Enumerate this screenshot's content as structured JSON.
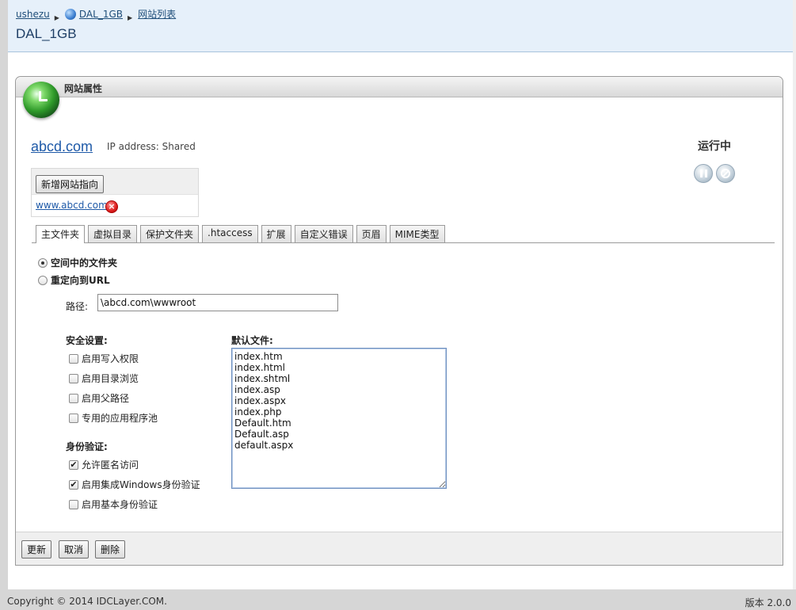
{
  "breadcrumb": {
    "items": [
      "ushezu",
      "DAL_1GB",
      "网站列表"
    ]
  },
  "header": {
    "title": "DAL_1GB"
  },
  "panel": {
    "title": "网站属性"
  },
  "site": {
    "domain": "abcd.com",
    "ip_info": "IP address: Shared",
    "status": "运行中"
  },
  "pointers": {
    "add_button": "新增网站指向",
    "items": [
      "www.abcd.com"
    ]
  },
  "tabs": [
    "主文件夹",
    "虚拟目录",
    "保护文件夹",
    ".htaccess",
    "扩展",
    "自定义错误",
    "页眉",
    "MIME类型"
  ],
  "home_folder": {
    "option_folder": "空间中的文件夹",
    "option_redirect": "重定向到URL",
    "path_label": "路径:",
    "path_value": "\\abcd.com\\wwwroot"
  },
  "security": {
    "title": "安全设置:",
    "options": [
      {
        "label": "启用写入权限",
        "checked": false
      },
      {
        "label": "启用目录浏览",
        "checked": false
      },
      {
        "label": "启用父路径",
        "checked": false
      },
      {
        "label": "专用的应用程序池",
        "checked": false
      }
    ]
  },
  "auth": {
    "title": "身份验证:",
    "options": [
      {
        "label": "允许匿名访问",
        "checked": true
      },
      {
        "label": "启用集成Windows身份验证",
        "checked": true
      },
      {
        "label": "启用基本身份验证",
        "checked": false
      }
    ]
  },
  "default_docs": {
    "title": "默认文件:",
    "value": "index.htm\nindex.html\nindex.shtml\nindex.asp\nindex.aspx\nindex.php\nDefault.htm\nDefault.asp\ndefault.aspx"
  },
  "footer": {
    "update": "更新",
    "cancel": "取消",
    "delete": "删除"
  },
  "bottom": {
    "copyright": "Copyright © 2014 IDCLayer.COM.",
    "version": "版本 2.0.0"
  }
}
